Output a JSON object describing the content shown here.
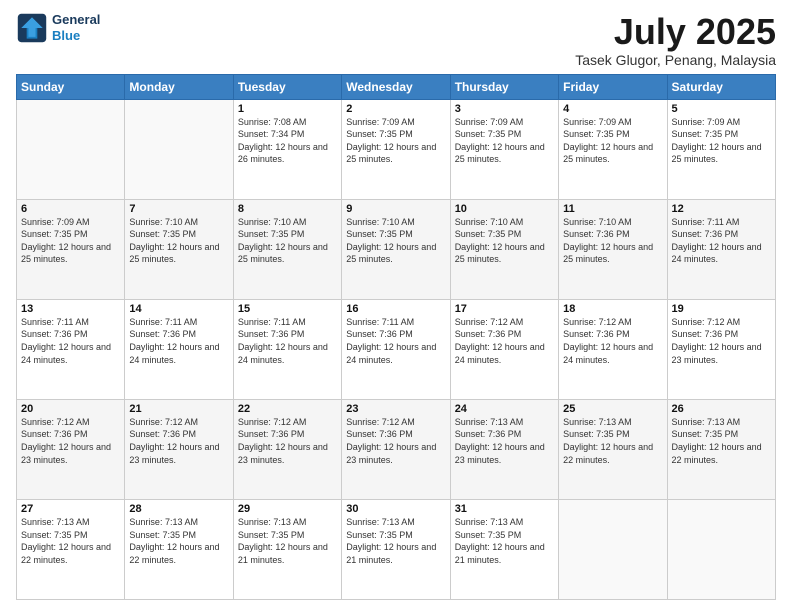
{
  "header": {
    "logo_line1": "General",
    "logo_line2": "Blue",
    "month": "July 2025",
    "location": "Tasek Glugor, Penang, Malaysia"
  },
  "days_of_week": [
    "Sunday",
    "Monday",
    "Tuesday",
    "Wednesday",
    "Thursday",
    "Friday",
    "Saturday"
  ],
  "weeks": [
    [
      {
        "day": "",
        "sunrise": "",
        "sunset": "",
        "daylight": ""
      },
      {
        "day": "",
        "sunrise": "",
        "sunset": "",
        "daylight": ""
      },
      {
        "day": "1",
        "sunrise": "Sunrise: 7:08 AM",
        "sunset": "Sunset: 7:34 PM",
        "daylight": "Daylight: 12 hours and 26 minutes."
      },
      {
        "day": "2",
        "sunrise": "Sunrise: 7:09 AM",
        "sunset": "Sunset: 7:35 PM",
        "daylight": "Daylight: 12 hours and 25 minutes."
      },
      {
        "day": "3",
        "sunrise": "Sunrise: 7:09 AM",
        "sunset": "Sunset: 7:35 PM",
        "daylight": "Daylight: 12 hours and 25 minutes."
      },
      {
        "day": "4",
        "sunrise": "Sunrise: 7:09 AM",
        "sunset": "Sunset: 7:35 PM",
        "daylight": "Daylight: 12 hours and 25 minutes."
      },
      {
        "day": "5",
        "sunrise": "Sunrise: 7:09 AM",
        "sunset": "Sunset: 7:35 PM",
        "daylight": "Daylight: 12 hours and 25 minutes."
      }
    ],
    [
      {
        "day": "6",
        "sunrise": "Sunrise: 7:09 AM",
        "sunset": "Sunset: 7:35 PM",
        "daylight": "Daylight: 12 hours and 25 minutes."
      },
      {
        "day": "7",
        "sunrise": "Sunrise: 7:10 AM",
        "sunset": "Sunset: 7:35 PM",
        "daylight": "Daylight: 12 hours and 25 minutes."
      },
      {
        "day": "8",
        "sunrise": "Sunrise: 7:10 AM",
        "sunset": "Sunset: 7:35 PM",
        "daylight": "Daylight: 12 hours and 25 minutes."
      },
      {
        "day": "9",
        "sunrise": "Sunrise: 7:10 AM",
        "sunset": "Sunset: 7:35 PM",
        "daylight": "Daylight: 12 hours and 25 minutes."
      },
      {
        "day": "10",
        "sunrise": "Sunrise: 7:10 AM",
        "sunset": "Sunset: 7:35 PM",
        "daylight": "Daylight: 12 hours and 25 minutes."
      },
      {
        "day": "11",
        "sunrise": "Sunrise: 7:10 AM",
        "sunset": "Sunset: 7:36 PM",
        "daylight": "Daylight: 12 hours and 25 minutes."
      },
      {
        "day": "12",
        "sunrise": "Sunrise: 7:11 AM",
        "sunset": "Sunset: 7:36 PM",
        "daylight": "Daylight: 12 hours and 24 minutes."
      }
    ],
    [
      {
        "day": "13",
        "sunrise": "Sunrise: 7:11 AM",
        "sunset": "Sunset: 7:36 PM",
        "daylight": "Daylight: 12 hours and 24 minutes."
      },
      {
        "day": "14",
        "sunrise": "Sunrise: 7:11 AM",
        "sunset": "Sunset: 7:36 PM",
        "daylight": "Daylight: 12 hours and 24 minutes."
      },
      {
        "day": "15",
        "sunrise": "Sunrise: 7:11 AM",
        "sunset": "Sunset: 7:36 PM",
        "daylight": "Daylight: 12 hours and 24 minutes."
      },
      {
        "day": "16",
        "sunrise": "Sunrise: 7:11 AM",
        "sunset": "Sunset: 7:36 PM",
        "daylight": "Daylight: 12 hours and 24 minutes."
      },
      {
        "day": "17",
        "sunrise": "Sunrise: 7:12 AM",
        "sunset": "Sunset: 7:36 PM",
        "daylight": "Daylight: 12 hours and 24 minutes."
      },
      {
        "day": "18",
        "sunrise": "Sunrise: 7:12 AM",
        "sunset": "Sunset: 7:36 PM",
        "daylight": "Daylight: 12 hours and 24 minutes."
      },
      {
        "day": "19",
        "sunrise": "Sunrise: 7:12 AM",
        "sunset": "Sunset: 7:36 PM",
        "daylight": "Daylight: 12 hours and 23 minutes."
      }
    ],
    [
      {
        "day": "20",
        "sunrise": "Sunrise: 7:12 AM",
        "sunset": "Sunset: 7:36 PM",
        "daylight": "Daylight: 12 hours and 23 minutes."
      },
      {
        "day": "21",
        "sunrise": "Sunrise: 7:12 AM",
        "sunset": "Sunset: 7:36 PM",
        "daylight": "Daylight: 12 hours and 23 minutes."
      },
      {
        "day": "22",
        "sunrise": "Sunrise: 7:12 AM",
        "sunset": "Sunset: 7:36 PM",
        "daylight": "Daylight: 12 hours and 23 minutes."
      },
      {
        "day": "23",
        "sunrise": "Sunrise: 7:12 AM",
        "sunset": "Sunset: 7:36 PM",
        "daylight": "Daylight: 12 hours and 23 minutes."
      },
      {
        "day": "24",
        "sunrise": "Sunrise: 7:13 AM",
        "sunset": "Sunset: 7:36 PM",
        "daylight": "Daylight: 12 hours and 23 minutes."
      },
      {
        "day": "25",
        "sunrise": "Sunrise: 7:13 AM",
        "sunset": "Sunset: 7:35 PM",
        "daylight": "Daylight: 12 hours and 22 minutes."
      },
      {
        "day": "26",
        "sunrise": "Sunrise: 7:13 AM",
        "sunset": "Sunset: 7:35 PM",
        "daylight": "Daylight: 12 hours and 22 minutes."
      }
    ],
    [
      {
        "day": "27",
        "sunrise": "Sunrise: 7:13 AM",
        "sunset": "Sunset: 7:35 PM",
        "daylight": "Daylight: 12 hours and 22 minutes."
      },
      {
        "day": "28",
        "sunrise": "Sunrise: 7:13 AM",
        "sunset": "Sunset: 7:35 PM",
        "daylight": "Daylight: 12 hours and 22 minutes."
      },
      {
        "day": "29",
        "sunrise": "Sunrise: 7:13 AM",
        "sunset": "Sunset: 7:35 PM",
        "daylight": "Daylight: 12 hours and 21 minutes."
      },
      {
        "day": "30",
        "sunrise": "Sunrise: 7:13 AM",
        "sunset": "Sunset: 7:35 PM",
        "daylight": "Daylight: 12 hours and 21 minutes."
      },
      {
        "day": "31",
        "sunrise": "Sunrise: 7:13 AM",
        "sunset": "Sunset: 7:35 PM",
        "daylight": "Daylight: 12 hours and 21 minutes."
      },
      {
        "day": "",
        "sunrise": "",
        "sunset": "",
        "daylight": ""
      },
      {
        "day": "",
        "sunrise": "",
        "sunset": "",
        "daylight": ""
      }
    ]
  ]
}
